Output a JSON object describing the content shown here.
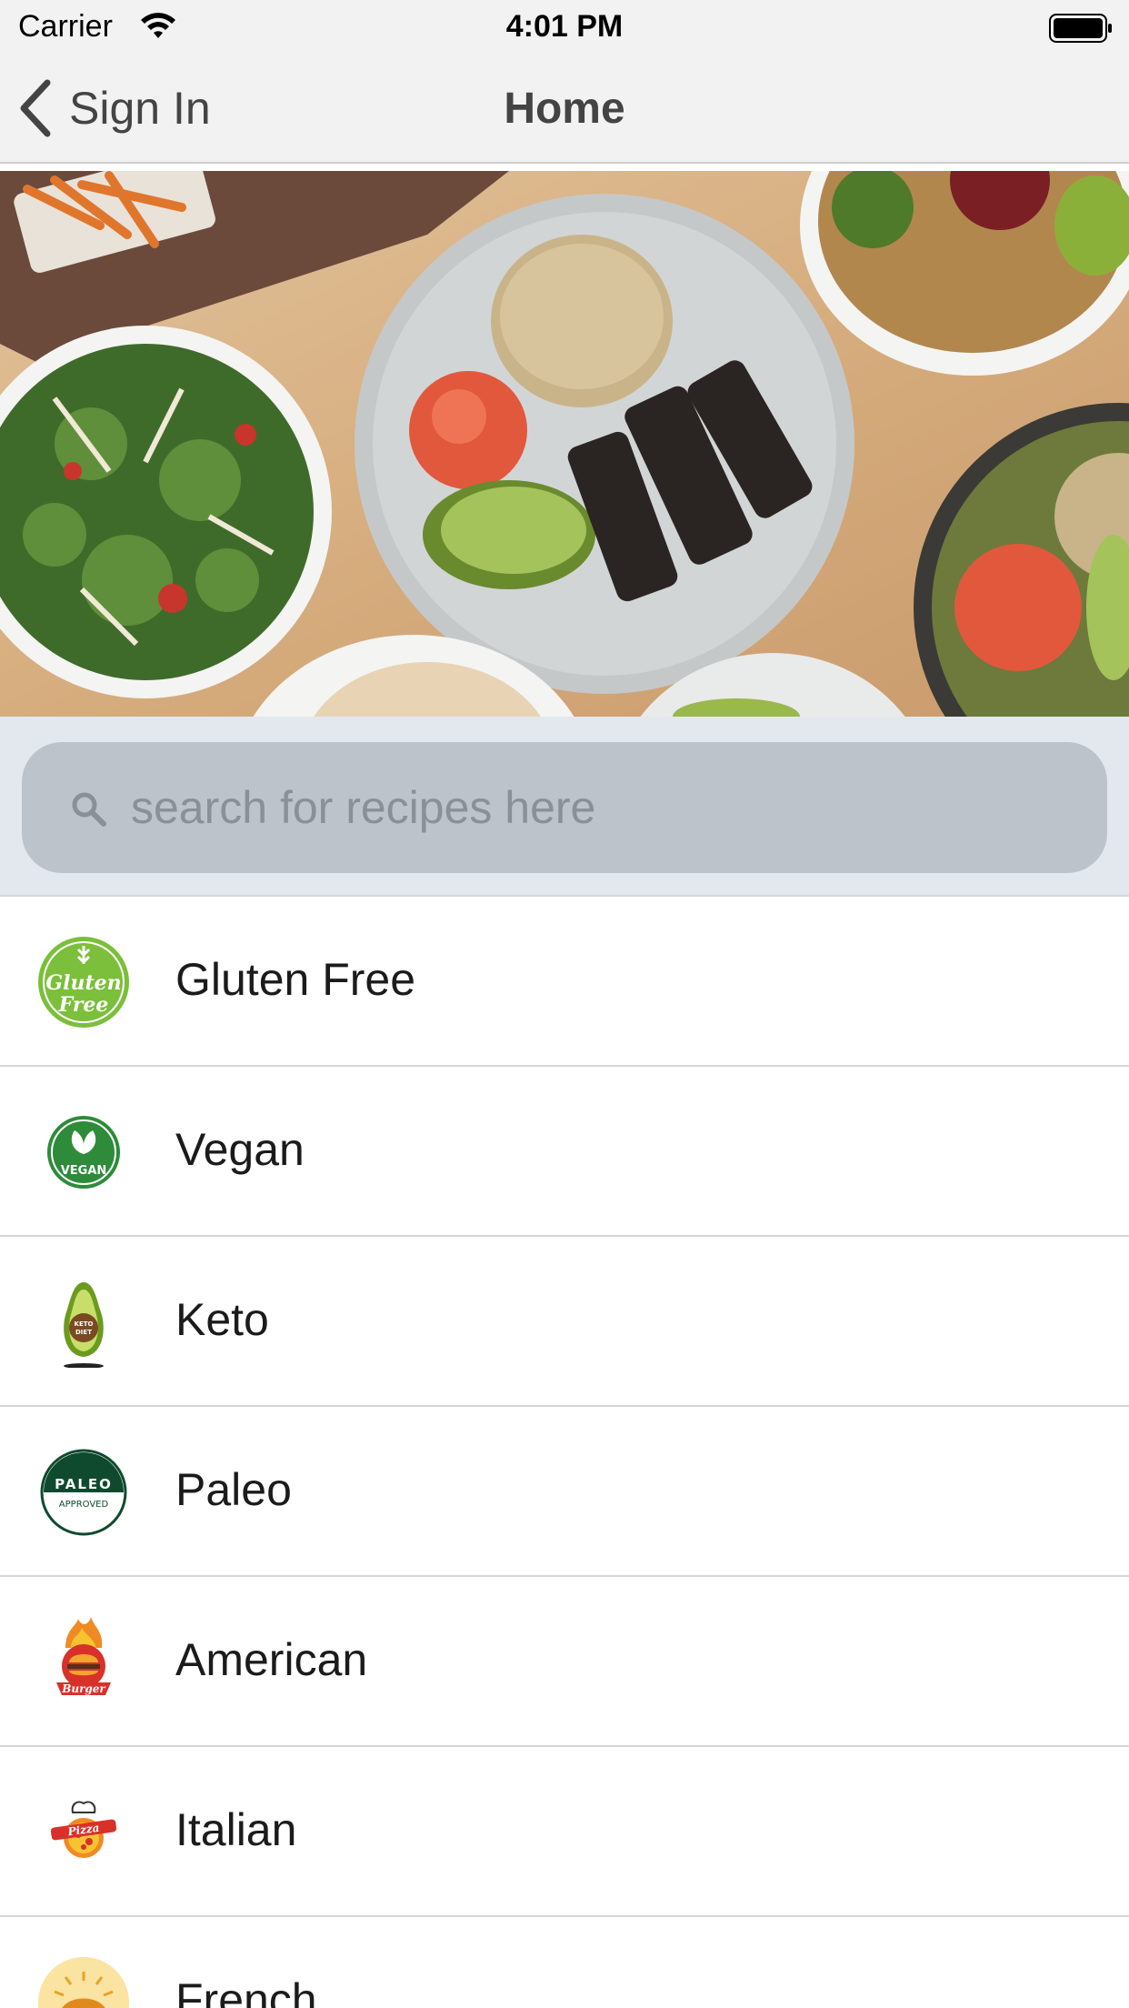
{
  "status_bar": {
    "carrier": "Carrier",
    "time": "4:01 PM"
  },
  "nav": {
    "back_label": "Sign In",
    "title": "Home"
  },
  "search": {
    "placeholder": "search for recipes here",
    "value": ""
  },
  "categories": [
    {
      "label": "Gluten Free",
      "icon": "gluten-free-icon",
      "icon_text": "Gluten Free"
    },
    {
      "label": "Vegan",
      "icon": "vegan-icon",
      "icon_text": "VEGAN"
    },
    {
      "label": "Keto",
      "icon": "keto-icon",
      "icon_text": "KETO DIET"
    },
    {
      "label": "Paleo",
      "icon": "paleo-icon",
      "icon_text": "PALEO APPROVED"
    },
    {
      "label": "American",
      "icon": "burger-icon",
      "icon_text": "Burger"
    },
    {
      "label": "Italian",
      "icon": "pizza-icon",
      "icon_text": "Pizza"
    },
    {
      "label": "French",
      "icon": "croissant-icon",
      "icon_text": ""
    }
  ],
  "colors": {
    "bar_background": "#f2f2f2",
    "search_area": "#e3e8ee",
    "search_field": "#bcc3cb",
    "gluten_green": "#7bbf3a",
    "vegan_green": "#2e8b3a",
    "paleo_green": "#0f4a2e",
    "burger_red": "#d8312a"
  }
}
